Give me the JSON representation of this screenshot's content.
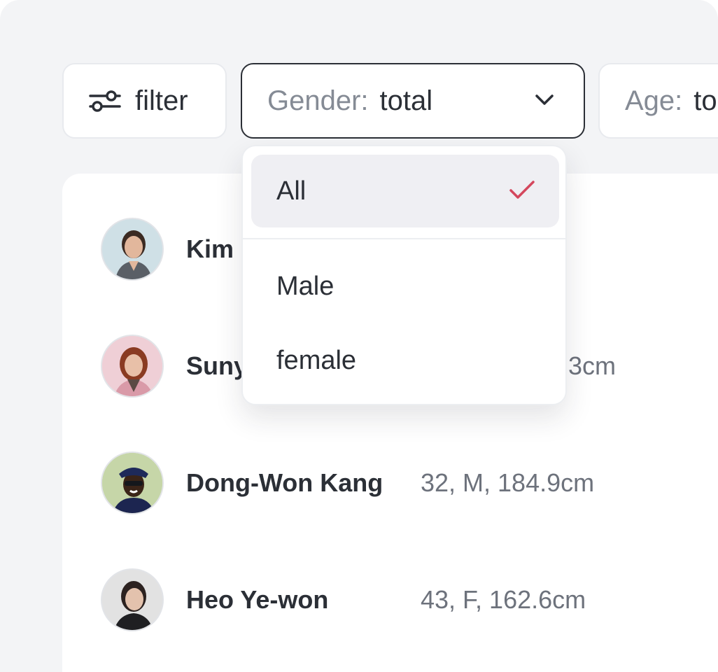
{
  "filters": {
    "filter_button": {
      "label": "filter",
      "icon": "sliders-icon"
    },
    "gender": {
      "label": "Gender:",
      "value": "total",
      "icon": "chevron-down-icon"
    },
    "age": {
      "label": "Age:",
      "value": "to"
    }
  },
  "dropdown": {
    "options": [
      {
        "label": "All",
        "selected": true
      },
      {
        "label": "Male",
        "selected": false
      },
      {
        "label": "female",
        "selected": false
      }
    ],
    "check_color": "#d4475d"
  },
  "people": [
    {
      "name": "Kim",
      "meta": ""
    },
    {
      "name": "Suny",
      "meta": "3cm"
    },
    {
      "name": "Dong-Won Kang",
      "meta": "32, M, 184.9cm"
    },
    {
      "name": "Heo Ye-won",
      "meta": "43, F, 162.6cm"
    }
  ]
}
